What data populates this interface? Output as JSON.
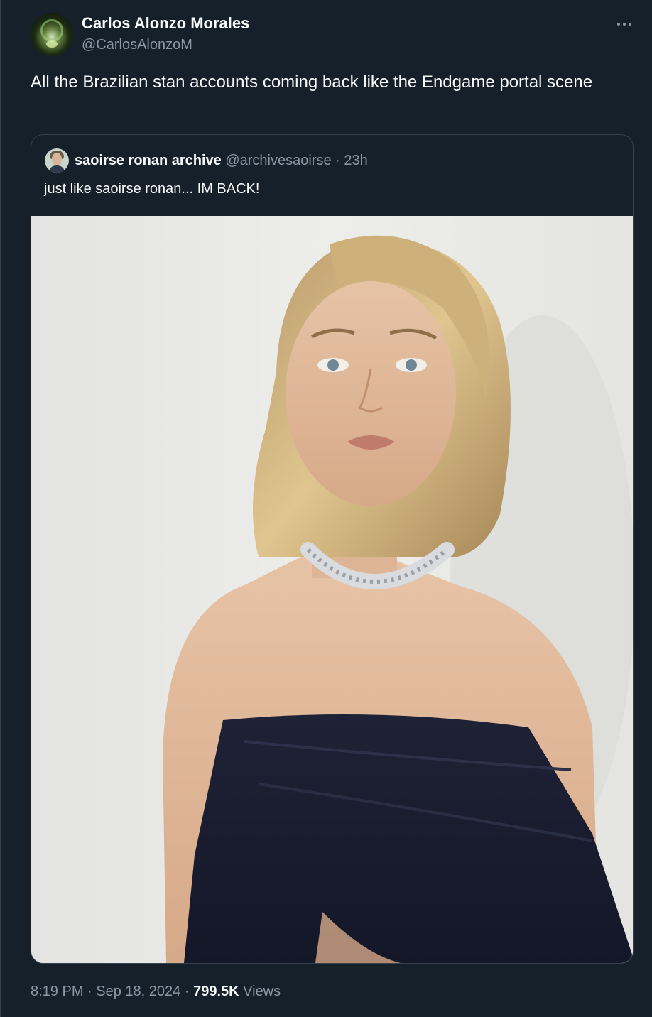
{
  "tweet": {
    "author": {
      "display_name": "Carlos Alonzo Morales",
      "handle": "@CarlosAlonzoM",
      "avatar_icon": "avatar-image"
    },
    "more_icon": "more-icon",
    "text": "All the Brazilian stan accounts coming back like the Endgame portal scene",
    "quote": {
      "author_name": "saoirse ronan archive",
      "author_handle": "@archivesaoirse",
      "separator": "·",
      "time": "23h",
      "text": "just like saoirse ronan... IM BACK!",
      "media_icon": "photo-image"
    },
    "footer": {
      "time": "8:19 PM",
      "sep1": "·",
      "date": "Sep 18, 2024",
      "sep2": "·",
      "views_count": "799.5K",
      "views_label": "Views"
    }
  },
  "colors": {
    "background": "#15202b",
    "primary_text": "#f7f9f9",
    "secondary_text": "#8b98a5",
    "border": "#38444d"
  }
}
